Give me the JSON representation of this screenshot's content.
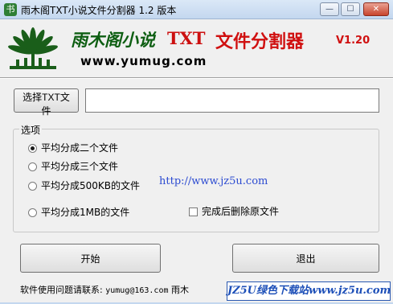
{
  "window": {
    "title": "雨木阁TXT小说文件分割器 1.2 版本",
    "controls": {
      "minimize": "—",
      "maximize": "☐",
      "close": "✕"
    }
  },
  "banner": {
    "brand_cn": "雨木阁小说",
    "brand_txt": "TXT",
    "brand_split": "文件分割器",
    "version": "V1.20",
    "site": "www.yumug.com",
    "logo": "tree-logo",
    "colors": {
      "brand_green": "#0d5e12",
      "brand_red": "#d01010"
    }
  },
  "file": {
    "select_button": "选择TXT文件",
    "path_value": ""
  },
  "options": {
    "label": "选项",
    "radios": [
      {
        "label": "平均分成二个文件",
        "selected": true
      },
      {
        "label": "平均分成三个文件",
        "selected": false
      },
      {
        "label": "平均分成500KB的文件",
        "selected": false
      },
      {
        "label": "平均分成1MB的文件",
        "selected": false
      }
    ],
    "delete_after": {
      "label": "完成后删除原文件",
      "checked": false
    },
    "site_link": "http://www.jz5u.com"
  },
  "actions": {
    "start": "开始",
    "exit": "退出"
  },
  "footer": {
    "contact_label": "软件使用问题请联系:",
    "email": "yumug@163.com",
    "author": "雨木"
  },
  "watermark": "JZ5U绿色下载站www.jz5u.com"
}
